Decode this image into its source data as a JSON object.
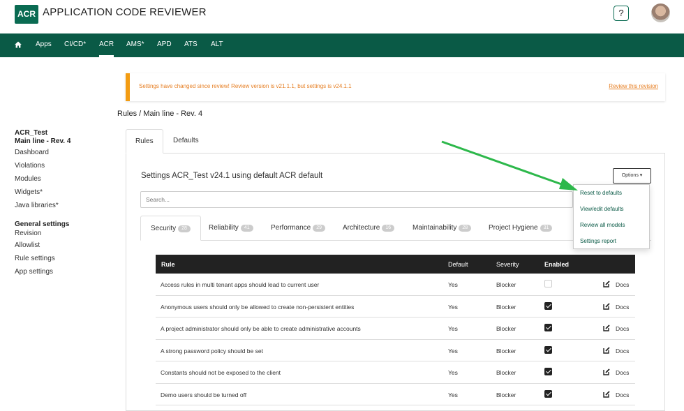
{
  "header": {
    "logo_text": "ACR",
    "app_title": "APPLICATION CODE REVIEWER",
    "help_label": "?"
  },
  "nav": {
    "items": [
      "Apps",
      "CI/CD*",
      "ACR",
      "AMS*",
      "APD",
      "ATS",
      "ALT"
    ],
    "active": "ACR"
  },
  "alert": {
    "message": "Settings have changed since review! Review version is v21.1.1, but settings is v24.1.1",
    "link": "Review this revision"
  },
  "breadcrumb": "Rules / Main line - Rev. 4",
  "sidebar": {
    "app_name": "ACR_Test",
    "revision": "Main line - Rev. 4",
    "links": [
      "Dashboard",
      "Violations",
      "Modules",
      "Widgets*",
      "Java libraries*"
    ],
    "group_title": "General settings",
    "group_links": [
      "Revision",
      "Allowlist",
      "Rule settings",
      "App settings"
    ]
  },
  "main_tabs": [
    "Rules",
    "Defaults"
  ],
  "settings_title": "Settings ACR_Test v24.1 using default ACR default",
  "options_label": "Options ▾",
  "search_placeholder": "Search...",
  "category_tabs": [
    {
      "label": "Security",
      "count": "28"
    },
    {
      "label": "Reliability",
      "count": "41"
    },
    {
      "label": "Performance",
      "count": "29"
    },
    {
      "label": "Architecture",
      "count": "16"
    },
    {
      "label": "Maintainability",
      "count": "28"
    },
    {
      "label": "Project Hygiene",
      "count": "31"
    }
  ],
  "table": {
    "headers": [
      "Rule",
      "Default",
      "Severity",
      "Enabled"
    ],
    "docs_label": "Docs",
    "rows": [
      {
        "rule": "Access rules in multi tenant apps should lead to current user",
        "default": "Yes",
        "severity": "Blocker",
        "enabled": false
      },
      {
        "rule": "Anonymous users should only be allowed to create non-persistent entities",
        "default": "Yes",
        "severity": "Blocker",
        "enabled": true
      },
      {
        "rule": "A project administrator should only be able to create administrative accounts",
        "default": "Yes",
        "severity": "Blocker",
        "enabled": true
      },
      {
        "rule": "A strong password policy should be set",
        "default": "Yes",
        "severity": "Blocker",
        "enabled": true
      },
      {
        "rule": "Constants should not be exposed to the client",
        "default": "Yes",
        "severity": "Blocker",
        "enabled": true
      },
      {
        "rule": "Demo users should be turned off",
        "default": "Yes",
        "severity": "Blocker",
        "enabled": true
      }
    ]
  },
  "options_menu": [
    "Reset to defaults",
    "View/edit defaults",
    "Review all models",
    "Settings report"
  ],
  "colors": {
    "brand": "#0a5a46",
    "warning": "#f39c12",
    "annotation_arrow": "#2db84b"
  }
}
